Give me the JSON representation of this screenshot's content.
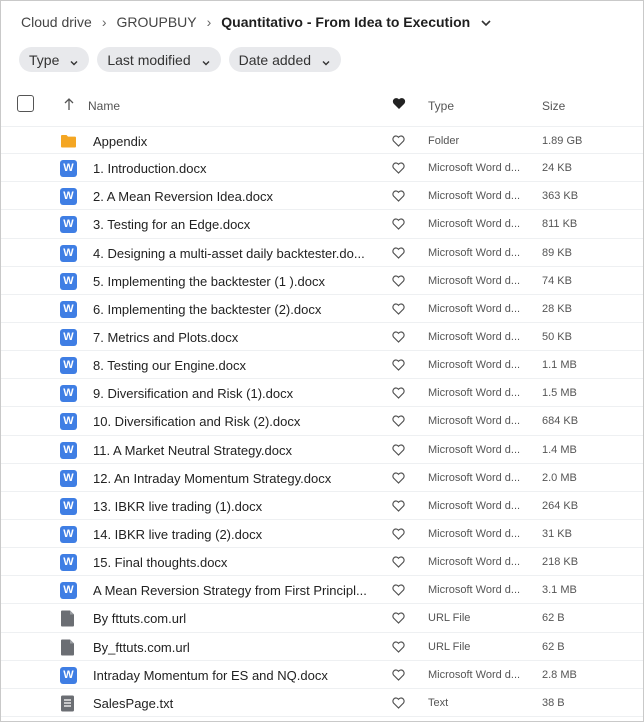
{
  "breadcrumb": {
    "root": "Cloud drive",
    "parent": "GROUPBUY",
    "current": "Quantitativo - From Idea to Execution"
  },
  "filters": [
    {
      "label": "Type"
    },
    {
      "label": "Last modified"
    },
    {
      "label": "Date added"
    }
  ],
  "columns": {
    "name": "Name",
    "type": "Type",
    "size": "Size"
  },
  "files": [
    {
      "icon": "folder-icon",
      "name": "Appendix",
      "type": "Folder",
      "size": "1.89 GB"
    },
    {
      "icon": "word-icon",
      "name": "1. Introduction.docx",
      "type": "Microsoft Word d...",
      "size": "24 KB"
    },
    {
      "icon": "word-icon",
      "name": "2. A Mean Reversion Idea.docx",
      "type": "Microsoft Word d...",
      "size": "363 KB"
    },
    {
      "icon": "word-icon",
      "name": "3. Testing for an Edge.docx",
      "type": "Microsoft Word d...",
      "size": "811 KB"
    },
    {
      "icon": "word-icon",
      "name": "4. Designing a multi-asset daily backtester.do...",
      "type": "Microsoft Word d...",
      "size": "89 KB"
    },
    {
      "icon": "word-icon",
      "name": "5. Implementing the backtester (1 ).docx",
      "type": "Microsoft Word d...",
      "size": "74 KB"
    },
    {
      "icon": "word-icon",
      "name": "6. Implementing the backtester (2).docx",
      "type": "Microsoft Word d...",
      "size": "28 KB"
    },
    {
      "icon": "word-icon",
      "name": "7. Metrics and Plots.docx",
      "type": "Microsoft Word d...",
      "size": "50 KB"
    },
    {
      "icon": "word-icon",
      "name": "8. Testing our Engine.docx",
      "type": "Microsoft Word d...",
      "size": "1.1 MB"
    },
    {
      "icon": "word-icon",
      "name": "9. Diversification and Risk (1).docx",
      "type": "Microsoft Word d...",
      "size": "1.5 MB"
    },
    {
      "icon": "word-icon",
      "name": "10. Diversification and Risk (2).docx",
      "type": "Microsoft Word d...",
      "size": "684 KB"
    },
    {
      "icon": "word-icon",
      "name": "11. A Market Neutral Strategy.docx",
      "type": "Microsoft Word d...",
      "size": "1.4 MB"
    },
    {
      "icon": "word-icon",
      "name": "12. An Intraday Momentum Strategy.docx",
      "type": "Microsoft Word d...",
      "size": "2.0 MB"
    },
    {
      "icon": "word-icon",
      "name": "13. IBKR live trading (1).docx",
      "type": "Microsoft Word d...",
      "size": "264 KB"
    },
    {
      "icon": "word-icon",
      "name": "14. IBKR live trading (2).docx",
      "type": "Microsoft Word d...",
      "size": "31 KB"
    },
    {
      "icon": "word-icon",
      "name": "15. Final thoughts.docx",
      "type": "Microsoft Word d...",
      "size": "218 KB"
    },
    {
      "icon": "word-icon",
      "name": "A Mean Reversion Strategy from First Principl...",
      "type": "Microsoft Word d...",
      "size": "3.1 MB"
    },
    {
      "icon": "url-file-icon",
      "name": "By fttuts.com.url",
      "type": "URL File",
      "size": "62 B"
    },
    {
      "icon": "url-file-icon",
      "name": "By_fttuts.com.url",
      "type": "URL File",
      "size": "62 B"
    },
    {
      "icon": "word-icon",
      "name": "Intraday Momentum for ES and NQ.docx",
      "type": "Microsoft Word d...",
      "size": "2.8 MB"
    },
    {
      "icon": "text-file-icon",
      "name": "SalesPage.txt",
      "type": "Text",
      "size": "38 B"
    }
  ],
  "colors": {
    "word": "#3f7ee4",
    "folder": "#f4a623",
    "generic_file": "#6b6e73"
  }
}
